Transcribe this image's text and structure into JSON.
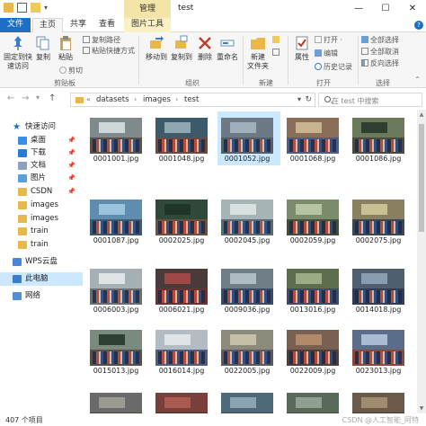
{
  "window": {
    "manage_tab": "管理",
    "title": "test",
    "minimize": "—",
    "maximize": "☐",
    "close": "✕"
  },
  "tabs": [
    "文件",
    "主页",
    "共享",
    "查看",
    "图片工具"
  ],
  "ribbon": {
    "pin_quick_access": "固定到快速访问",
    "copy": "复制",
    "paste": "粘贴",
    "cut": "剪切",
    "copy_path": "复制路径",
    "paste_shortcut": "粘贴快捷方式",
    "move_to": "移动到",
    "copy_to": "复制到",
    "delete": "删除",
    "rename": "重命名",
    "new_folder": "新建\n文件夹",
    "properties": "属性",
    "open": "打开 ·",
    "edit": "编辑",
    "history": "历史记录",
    "select_all": "全部选择",
    "select_none": "全部取消",
    "invert_selection": "反向选择",
    "groups": {
      "clipboard": "剪贴板",
      "organize": "组织",
      "new": "新建",
      "open": "打开",
      "select": "选择"
    }
  },
  "address": {
    "crumbs": [
      "datasets",
      "images",
      "test"
    ],
    "search_placeholder": "在 test 中搜索"
  },
  "nav": [
    {
      "label": "快速访问",
      "icon": "star-icon",
      "color": "#1c6fc4",
      "pinned": false
    },
    {
      "label": "桌面",
      "icon": "desktop-icon",
      "color": "#3a8ee6",
      "pinned": true
    },
    {
      "label": "下载",
      "icon": "download-icon",
      "color": "#2a7ad8",
      "pinned": true
    },
    {
      "label": "文档",
      "icon": "documents-icon",
      "color": "#8aa2c0",
      "pinned": true
    },
    {
      "label": "图片",
      "icon": "pictures-icon",
      "color": "#5aa0d8",
      "pinned": true
    },
    {
      "label": "CSDN",
      "icon": "folder-icon",
      "color": "#e8b84a",
      "pinned": true
    },
    {
      "label": "images",
      "icon": "folder-icon",
      "color": "#e8b84a",
      "pinned": false
    },
    {
      "label": "images",
      "icon": "folder-icon",
      "color": "#e8b84a",
      "pinned": false
    },
    {
      "label": "train",
      "icon": "folder-icon",
      "color": "#e8b84a",
      "pinned": false
    },
    {
      "label": "train",
      "icon": "folder-icon",
      "color": "#e8b84a",
      "pinned": false
    },
    {
      "label": "WPS云盘",
      "icon": "cloud-icon",
      "color": "#4a86d8",
      "pinned": false
    },
    {
      "label": "此电脑",
      "icon": "computer-icon",
      "color": "#3a7ccf",
      "pinned": false
    },
    {
      "label": "网络",
      "icon": "network-icon",
      "color": "#4f8fd6",
      "pinned": false
    }
  ],
  "files": [
    {
      "name": "0001001.jpg",
      "wall": "#7f8a8c",
      "floor": "#5a5248",
      "board": "#cfd8d8"
    },
    {
      "name": "0001048.jpg",
      "wall": "#3c5a6a",
      "floor": "#6f4a3a",
      "board": "#8fa7b0"
    },
    {
      "name": "0001052.jpg",
      "wall": "#6d7a86",
      "floor": "#53606a",
      "board": "#9db0bb"
    },
    {
      "name": "0001068.jpg",
      "wall": "#8a6d58",
      "floor": "#4b5e8a",
      "board": "#c9b28f"
    },
    {
      "name": "0001086.jpg",
      "wall": "#6c7a5c",
      "floor": "#4a4a3e",
      "board": "#2f3f2f"
    },
    {
      "name": "0001087.jpg",
      "wall": "#5f8db0",
      "floor": "#3f5a70",
      "board": "#9bc3de"
    },
    {
      "name": "0002025.jpg",
      "wall": "#2f4a3a",
      "floor": "#6c5140",
      "board": "#1f3528"
    },
    {
      "name": "0002045.jpg",
      "wall": "#a7b4b6",
      "floor": "#566c72",
      "board": "#d9e0e0"
    },
    {
      "name": "0002059.jpg",
      "wall": "#7b8c6a",
      "floor": "#3f4f3a",
      "board": "#b6c4a4"
    },
    {
      "name": "0002075.jpg",
      "wall": "#8a7f5e",
      "floor": "#3a4652",
      "board": "#cbbf94"
    },
    {
      "name": "0006003.jpg",
      "wall": "#a5b0b5",
      "floor": "#6a6e70",
      "board": "#dfe5e7"
    },
    {
      "name": "0006021.jpg",
      "wall": "#4a3a3a",
      "floor": "#6e2f2f",
      "board": "#a04848"
    },
    {
      "name": "0009036.jpg",
      "wall": "#6e7d86",
      "floor": "#3d4a66",
      "board": "#b0bcc4"
    },
    {
      "name": "0013016.jpg",
      "wall": "#5c6e4e",
      "floor": "#3b4d6a",
      "board": "#9bab85"
    },
    {
      "name": "0014018.jpg",
      "wall": "#4f5f70",
      "floor": "#2f3e55",
      "board": "#8a9cb0"
    },
    {
      "name": "0015013.jpg",
      "wall": "#7b8a7e",
      "floor": "#57504a",
      "board": "#2d3f33"
    },
    {
      "name": "0016014.jpg",
      "wall": "#b3bcc2",
      "floor": "#4e5e7c",
      "board": "#dfe4e8"
    },
    {
      "name": "0022005.jpg",
      "wall": "#8c8a7a",
      "floor": "#5a5a64",
      "board": "#c4c0a8"
    },
    {
      "name": "0022009.jpg",
      "wall": "#7a6050",
      "floor": "#4a3f3a",
      "board": "#b08a6a"
    },
    {
      "name": "0023013.jpg",
      "wall": "#5a6e8a",
      "floor": "#8a4a3a",
      "board": "#a9bcd3"
    },
    {
      "name": "",
      "wall": "#6a6a6a",
      "floor": "#4a4036",
      "board": "#9a9a90"
    },
    {
      "name": "",
      "wall": "#7a3f3a",
      "floor": "#4a2f2a",
      "board": "#a85a50"
    },
    {
      "name": "",
      "wall": "#4e6a7a",
      "floor": "#3a4a58",
      "board": "#8aa4b4"
    },
    {
      "name": "",
      "wall": "#5a6a5a",
      "floor": "#3e4a3e",
      "board": "#8fa08f"
    },
    {
      "name": "",
      "wall": "#6a5a4a",
      "floor": "#3e3a34",
      "board": "#a08a70"
    }
  ],
  "selected_file": "0001052.jpg",
  "status": {
    "count": "407 个项目",
    "watermark": "CSDN @人工智能_阿特"
  }
}
